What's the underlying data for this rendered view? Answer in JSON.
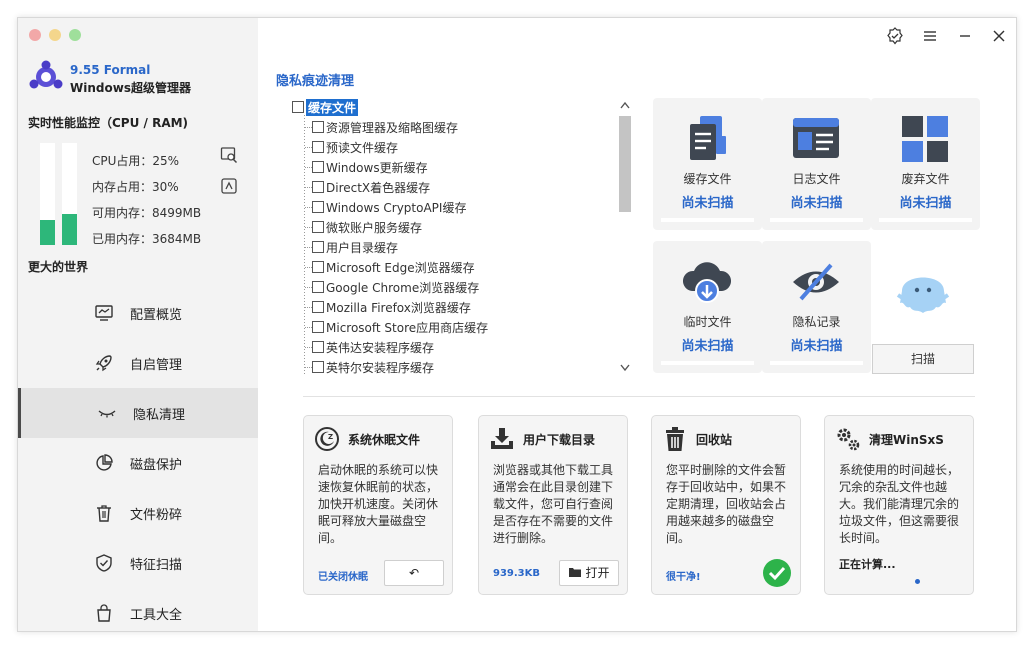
{
  "app": {
    "version": "9.55 Formal",
    "name": "Windows超级管理器",
    "accent": "#2a67c9",
    "traffic_lights": [
      "#f2a8a8",
      "#f4d68c",
      "#9fdf9b"
    ]
  },
  "monitor": {
    "title": "实时性能监控（CPU / RAM)",
    "cpu_label": "CPU占用：25%",
    "mem_label": "内存占用：30%",
    "avail_label": "可用内存：8499MB",
    "used_label": "已用内存：3684MB",
    "cpu_level": 0.25,
    "mem_level": 0.3,
    "tagline": "更大的世界"
  },
  "nav": [
    {
      "label": "配置概览",
      "icon": "monitor-icon"
    },
    {
      "label": "自启管理",
      "icon": "rocket-icon"
    },
    {
      "label": "隐私清理",
      "icon": "closed-eye-icon"
    },
    {
      "label": "磁盘保护",
      "icon": "pie-chart-icon"
    },
    {
      "label": "文件粉碎",
      "icon": "trash-icon"
    },
    {
      "label": "特征扫描",
      "icon": "shield-check-icon"
    },
    {
      "label": "工具大全",
      "icon": "bag-icon"
    }
  ],
  "section_title": "隐私痕迹清理",
  "tree": {
    "root": "缓存文件",
    "items": [
      "资源管理器及缩略图缓存",
      "预读文件缓存",
      "Windows更新缓存",
      "DirectX着色器缓存",
      "Windows CryptoAPI缓存",
      "微软账户服务缓存",
      "用户目录缓存",
      "Microsoft Edge浏览器缓存",
      "Google Chrome浏览器缓存",
      "Mozilla Firefox浏览器缓存",
      "Microsoft Store应用商店缓存",
      "英伟达安装程序缓存",
      "英特尔安装程序缓存"
    ]
  },
  "cards": [
    {
      "name": "缓存文件",
      "status": "尚未扫描",
      "icon": "document-stack-icon"
    },
    {
      "name": "日志文件",
      "status": "尚未扫描",
      "icon": "log-window-icon"
    },
    {
      "name": "废弃文件",
      "status": "尚未扫描",
      "icon": "grid-tiles-icon"
    },
    {
      "name": "临时文件",
      "status": "尚未扫描",
      "icon": "cloud-download-icon"
    },
    {
      "name": "隐私记录",
      "status": "尚未扫描",
      "icon": "eye-slash-icon"
    }
  ],
  "scan_button": "扫描",
  "tools": [
    {
      "title": "系统休眠文件",
      "desc": "启动休眠的系统可以快速恢复休眠前的状态，加快开机速度。关闭休眠可释放大量磁盘空间。",
      "foot": "已关闭休眠",
      "button": "↶"
    },
    {
      "title": "用户下载目录",
      "desc": "浏览器或其他下载工具通常会在此目录创建下载文件，您可自行查阅是否存在不需要的文件进行删除。",
      "foot": "939.3KB",
      "button": "打开"
    },
    {
      "title": "回收站",
      "desc": "您平时删除的文件会暂存于回收站中，如果不定期清理，回收站会占用越来越多的磁盘空间。",
      "foot": "很干净!"
    },
    {
      "title": "清理WinSxS",
      "desc": "系统使用的时间越长，冗余的杂乱文件也越大。我们能清理冗余的垃圾文件，但这需要很长时间。",
      "foot": "正在计算..."
    }
  ]
}
